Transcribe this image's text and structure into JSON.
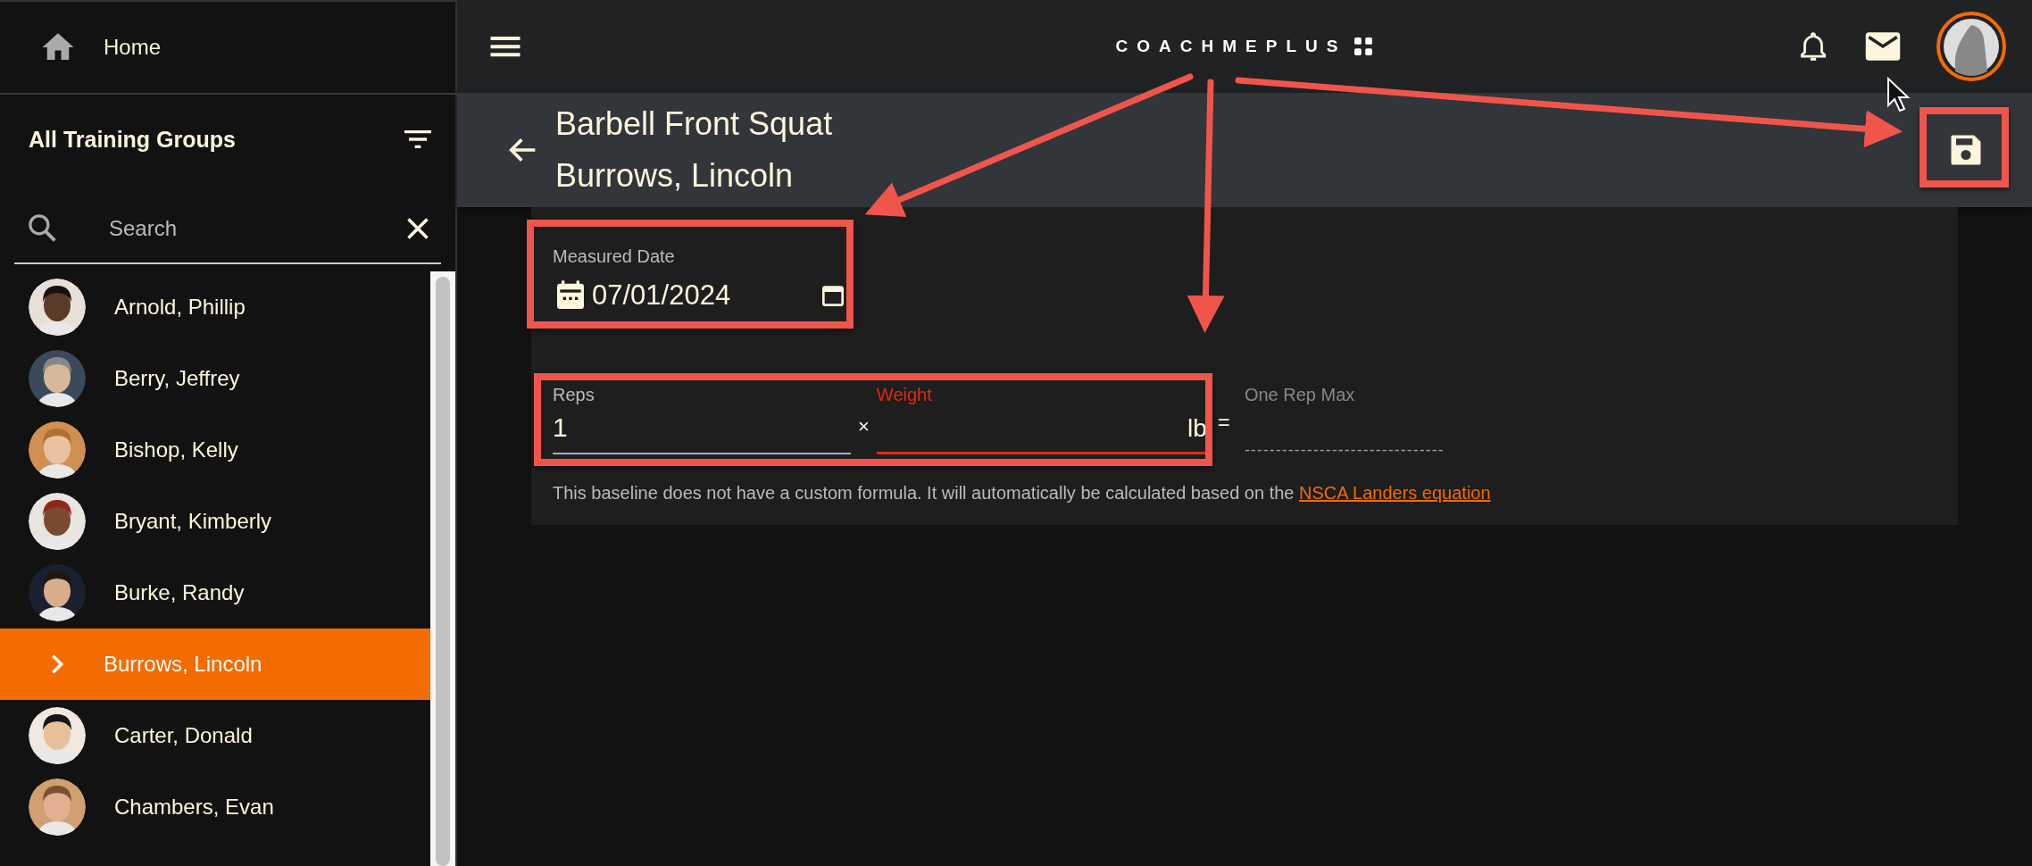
{
  "sidebar": {
    "home": {
      "label": "Home"
    },
    "group_title": "All Training Groups",
    "search": {
      "placeholder": "Search"
    },
    "athletes": [
      {
        "name": "Arnold, Phillip",
        "selected": false
      },
      {
        "name": "Berry, Jeffrey",
        "selected": false
      },
      {
        "name": "Bishop, Kelly",
        "selected": false
      },
      {
        "name": "Bryant, Kimberly",
        "selected": false
      },
      {
        "name": "Burke, Randy",
        "selected": false
      },
      {
        "name": "Burrows, Lincoln",
        "selected": true
      },
      {
        "name": "Carter, Donald",
        "selected": false
      },
      {
        "name": "Chambers, Evan",
        "selected": false
      }
    ]
  },
  "header": {
    "logo": "COACHMEPLUS"
  },
  "subheader": {
    "title": "Barbell Front Squat",
    "subtitle": "Burrows, Lincoln"
  },
  "form": {
    "date": {
      "label": "Measured Date",
      "value": "07/01/2024"
    },
    "reps": {
      "label": "Reps",
      "value": "1"
    },
    "multiply": "×",
    "weight": {
      "label": "Weight",
      "unit": "lb",
      "error": true
    },
    "equals": "=",
    "one_rep_max": {
      "label": "One Rep Max",
      "value": "--------------------------------"
    },
    "note": "This baseline does not have a custom formula. It will automatically be calculated based on the",
    "link": "NSCA Landers equation"
  }
}
